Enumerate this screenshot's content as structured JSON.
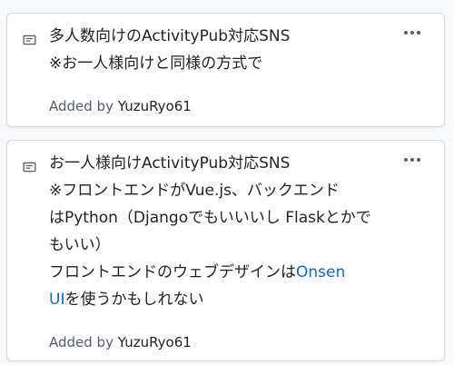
{
  "cards": [
    {
      "lines": [
        "多人数向けのActivityPub対応SNS",
        "※お一人様向けと同様の方式で"
      ],
      "added_prefix": "Added by",
      "added_user": "YuzuRyo61",
      "menu_icon": "kebab-horizontal-icon",
      "note_icon": "note-icon"
    },
    {
      "lines": [
        "お一人様向けActivityPub対応SNS",
        "※フロントエンドがVue.js、バックエンド",
        "はPython（Djangoでもいいいし Flaskとかで",
        "もいい）",
        "フロントエンドのウェブデザインは"
      ],
      "link_text_1": "Onsen",
      "line_6_link": "UI",
      "line_6_rest": "を使うかもしれない",
      "added_prefix": "Added by",
      "added_user": "YuzuRyo61",
      "menu_icon": "kebab-horizontal-icon",
      "note_icon": "note-icon"
    }
  ],
  "colors": {
    "link": "#0969da",
    "text": "#1f2328",
    "muted": "#57606a",
    "border": "#d5d9de",
    "background": "#f6f8fa"
  }
}
